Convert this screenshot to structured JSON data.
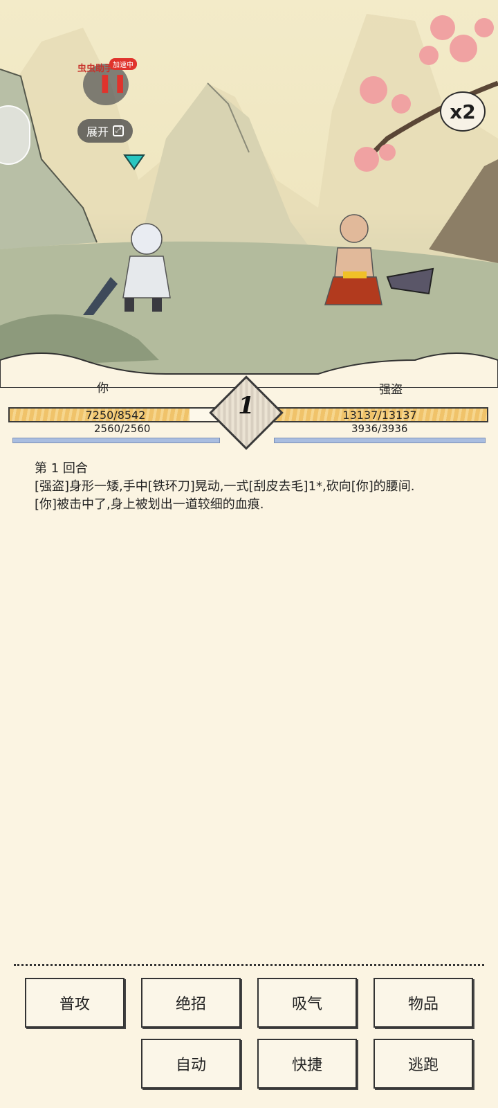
{
  "hud": {
    "assist_label": "虫虫助手",
    "assist_badge": "加速中",
    "expand_label": "展开",
    "speed_label": "x2"
  },
  "player": {
    "name": "你",
    "hp": "7250/8542",
    "hp_fraction": 0.849,
    "mp": "2560/2560",
    "mp_fraction": 1.0
  },
  "enemy": {
    "name": "强盗",
    "hp": "13137/13137",
    "hp_fraction": 1.0,
    "mp": "3936/3936",
    "mp_fraction": 1.0
  },
  "round": "1",
  "log": [
    "第 1 回合",
    "[强盗]身形一矮,手中[铁环刀]晃动,一式[刮皮去毛]1*,砍向[你]的腰间.",
    "[你]被击中了,身上被划出一道较细的血痕."
  ],
  "actions": {
    "attack": "普攻",
    "ultimate": "绝招",
    "breathe": "吸气",
    "items": "物品",
    "auto": "自动",
    "quick": "快捷",
    "flee": "逃跑"
  }
}
